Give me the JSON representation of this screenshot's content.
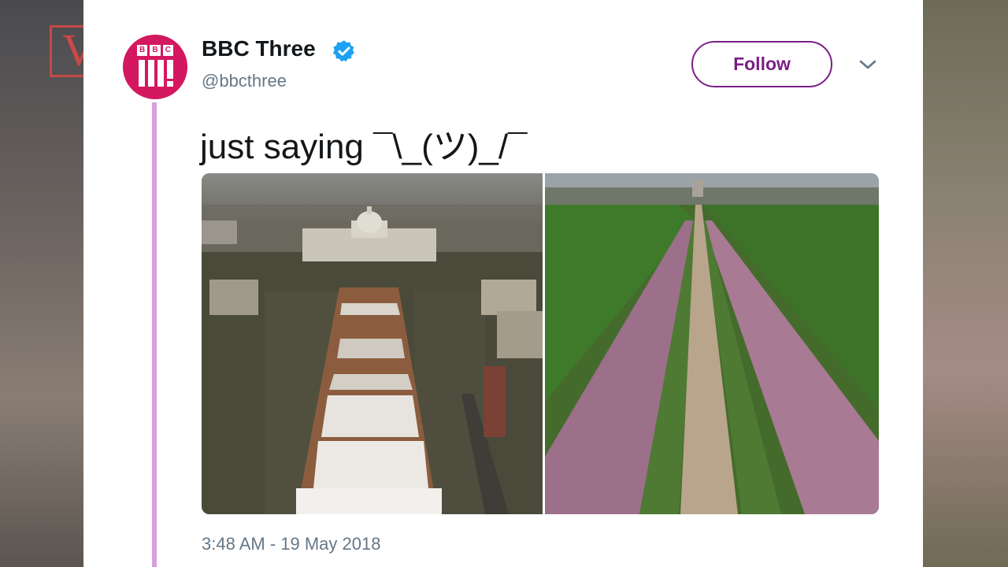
{
  "tweet": {
    "display_name": "BBC Three",
    "handle": "@bbcthree",
    "verified": true,
    "avatar_text": [
      "B",
      "B",
      "C"
    ],
    "text": "just saying ¯\\_(ツ)_/¯",
    "timestamp": "3:48 AM - 19 May 2018",
    "follow_label": "Follow",
    "media": [
      {
        "name": "inauguration-crowd-photo"
      },
      {
        "name": "royal-wedding-crowd-photo"
      }
    ]
  },
  "watermark": {
    "text": "V"
  },
  "colors": {
    "brand": "#d3185f",
    "follow": "#7a1f86",
    "verified": "#1da1f2",
    "thread_line": "#d9a0dd",
    "secondary_text": "#657786"
  },
  "icons": {
    "verified": "verified-badge-icon",
    "menu": "chevron-down-icon"
  }
}
